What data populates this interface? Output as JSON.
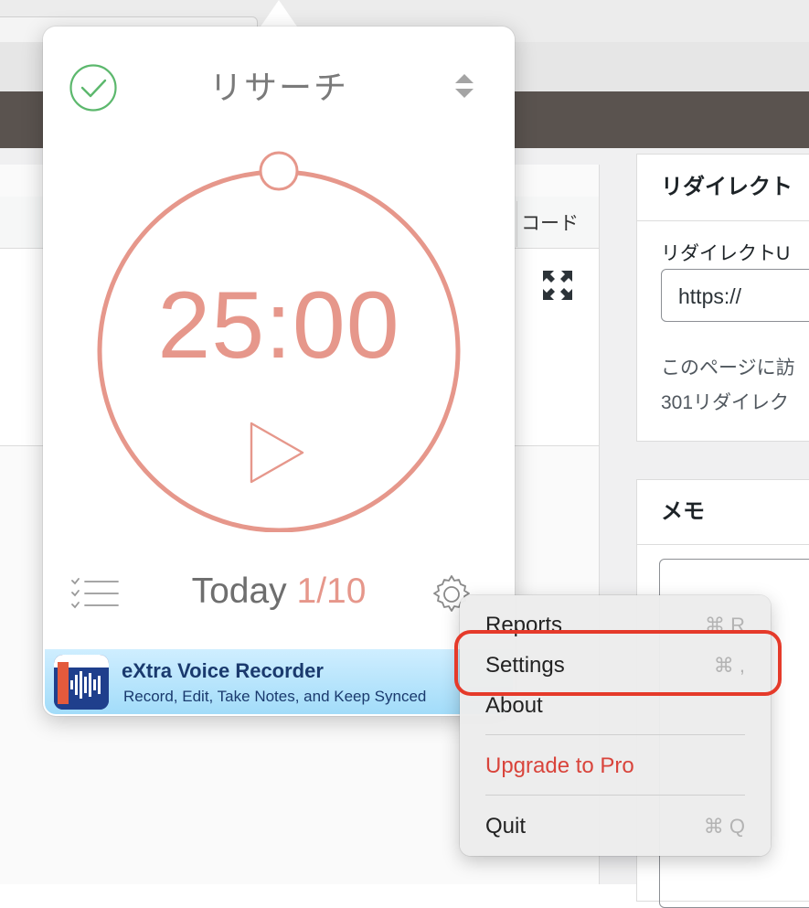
{
  "background": {
    "code_tab_label": "コード",
    "redirect_panel": {
      "title": "リダイレクト",
      "url_label": "リダイレクトU",
      "url_value": "https://",
      "description_line1": "このページに訪",
      "description_line2": "301リダイレク"
    },
    "memo_panel": {
      "title": "メモ"
    }
  },
  "popover": {
    "task_name": "リサーチ",
    "timer": "25:00",
    "today_label": "Today",
    "today_count": "1/10",
    "ad": {
      "title": "eXtra Voice Recorder",
      "subtitle": "Record, Edit, Take Notes, and Keep Synced"
    }
  },
  "menu": {
    "items": [
      {
        "label": "Reports",
        "shortcut": "⌘ R"
      },
      {
        "label": "Settings",
        "shortcut": "⌘ ,"
      },
      {
        "label": "About",
        "shortcut": ""
      },
      {
        "label": "Upgrade to Pro",
        "shortcut": ""
      },
      {
        "label": "Quit",
        "shortcut": "⌘ Q"
      }
    ]
  },
  "colors": {
    "accent_timer": "#e6978b",
    "check_green": "#5cb86d",
    "upgrade_red": "#d9443b",
    "highlight_red": "#e53a2a",
    "header_dark": "#5a534f"
  },
  "icons": [
    "check-circle-icon",
    "up-down-arrows-icon",
    "play-icon",
    "task-list-icon",
    "gear-icon",
    "expand-icon",
    "waveform-icon"
  ]
}
